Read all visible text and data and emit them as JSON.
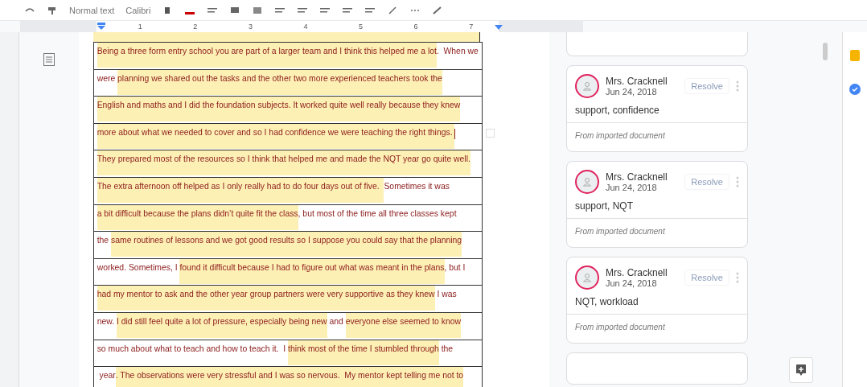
{
  "toolbar": {
    "style": "Normal text",
    "font": "Calibri"
  },
  "ruler": {
    "ticks": [
      "1",
      "2",
      "3",
      "4",
      "5",
      "6",
      "7"
    ]
  },
  "document": {
    "rows": [
      [
        {
          "text": "Being a three form entry school you are part of a larger team and I think this helped me a lot",
          "highlighted": true
        },
        {
          "text": ".  When we",
          "highlighted": false
        }
      ],
      [
        {
          "text": "were ",
          "highlighted": false
        },
        {
          "text": "planning we shared out the tasks and the other two more experienced teachers took the",
          "highlighted": true
        }
      ],
      [
        {
          "text": "English and maths and I did the foundation subjects. It worked quite well really because they knew",
          "highlighted": true
        }
      ],
      [
        {
          "text": "more about what we needed to cover and so I had confidence we were teaching the right things. ",
          "highlighted": true
        }
      ],
      [
        {
          "text": "They prepared most of the resources so I think that helped me and made the NQT year go quite well.",
          "highlighted": true
        }
      ],
      [
        {
          "text": "The extra afternoon off helped as I only really had to do four days out of five.  ",
          "highlighted": true
        },
        {
          "text": "Sometimes it was",
          "highlighted": false
        }
      ],
      [
        {
          "text": "a bit difficult because the plans didn’t quite fit the class",
          "highlighted": true
        },
        {
          "text": ", but most of the time all three classes kept",
          "highlighted": false
        }
      ],
      [
        {
          "text": "the ",
          "highlighted": false
        },
        {
          "text": "same routines of lessons and we got good results so I suppose you could say that the planning",
          "highlighted": true
        }
      ],
      [
        {
          "text": "worked. Sometimes, I ",
          "highlighted": false
        },
        {
          "text": "found it difficult because I had to figure out what was meant in the plans",
          "highlighted": true
        },
        {
          "text": ", but I",
          "highlighted": false
        }
      ],
      [
        {
          "text": "had my mentor to ask and the other year group partners were very supportive as they knew",
          "highlighted": true
        },
        {
          "text": " I was",
          "highlighted": false
        }
      ],
      [
        {
          "text": "new. ",
          "highlighted": false
        },
        {
          "text": "I did still feel quite a lot of pressure, especially being new",
          "highlighted": true
        },
        {
          "text": " and ",
          "highlighted": false
        },
        {
          "text": "everyone else seemed to know",
          "highlighted": true
        }
      ],
      [
        {
          "text": "so much about what to teach and how to teach it.  I ",
          "highlighted": false
        },
        {
          "text": "think most of the time I stumbled through",
          "highlighted": true
        },
        {
          "text": " the",
          "highlighted": false
        }
      ],
      [
        {
          "text": " year",
          "highlighted": false
        },
        {
          "text": ". The observations were very stressful and I was so nervous.  My mentor kept telling me not to",
          "highlighted": true
        }
      ]
    ]
  },
  "comments": [
    {
      "author": "Mrs. Cracknell",
      "date": "Jun 24, 2018",
      "resolve": "Resolve",
      "text": "support, confidence",
      "source": "From imported document"
    },
    {
      "author": "Mrs. Cracknell",
      "date": "Jun 24, 2018",
      "resolve": "Resolve",
      "text": "support, NQT",
      "source": "From imported document"
    },
    {
      "author": "Mrs. Cracknell",
      "date": "Jun 24, 2018",
      "resolve": "Resolve",
      "text": "NQT, workload",
      "source": "From imported document"
    }
  ]
}
